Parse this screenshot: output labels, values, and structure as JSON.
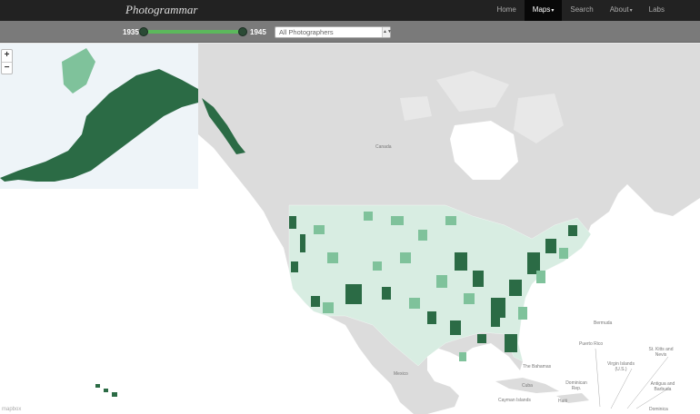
{
  "brand": "Photogrammar",
  "nav": {
    "home": "Home",
    "maps": "Maps",
    "search": "Search",
    "about": "About",
    "labs": "Labs"
  },
  "filters": {
    "year_start": "1935",
    "year_end": "1945",
    "photographer": "All Photographers"
  },
  "zoom": {
    "in": "+",
    "out": "−"
  },
  "map_labels": {
    "canada": "Canada",
    "mexico": "Mexico",
    "bermuda": "Bermuda",
    "bahamas": "The Bahamas",
    "cuba": "Cuba",
    "puerto_rico": "Puerto Rico",
    "virgin_islands": "Virgin Islands (U.S.)",
    "st_kitts": "St. Kitts and Nevis",
    "antigua": "Antigua and Barbuda",
    "dominican_republic": "Dominican Rep.",
    "haiti": "Haiti",
    "cayman": "Cayman Islands",
    "dominica": "Dominica"
  },
  "attribution": "mapbox",
  "colors": {
    "navbar": "#222222",
    "toolbar": "#7a7a7a",
    "land": "#dcdcdc",
    "water": "#ffffff",
    "county_light": "#d8ede2",
    "county_mid": "#7fc29b",
    "county_dark": "#2b6b45",
    "county_darkest": "#1e4d33"
  }
}
